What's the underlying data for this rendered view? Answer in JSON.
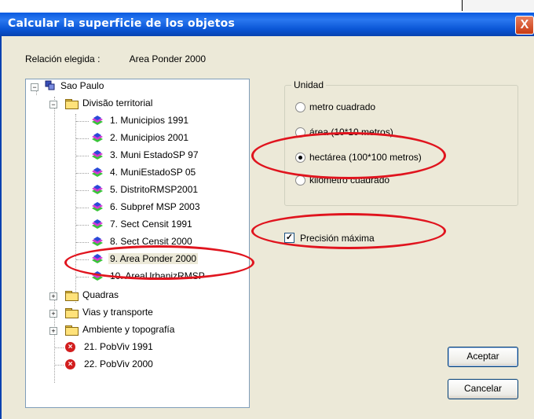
{
  "dialog": {
    "title": "Calcular la superficie de los objetos",
    "close_label": "X"
  },
  "relation": {
    "label": "Relación elegida :",
    "value": "Area Ponder 2000"
  },
  "tree": {
    "root": "Sao Paulo",
    "folder_divisao": "Divisão territorial",
    "layers": [
      "1. Municipios 1991",
      "2. Municipios 2001",
      "3. Muni EstadoSP 97",
      "4. MuniEstadoSP 05",
      "5. DistritoRMSP2001",
      "6. Subpref MSP 2003",
      "7. Sect Censit 1991",
      "8. Sect Censit 2000",
      "9. Area Ponder 2000",
      "10. AreaUrbanizRMSP"
    ],
    "selected_index": 8,
    "folders": [
      "Quadras",
      "Vias y transporte",
      "Ambiente y topografía"
    ],
    "error_layers": [
      "21. PobViv 1991",
      "22. PobViv 2000"
    ]
  },
  "units": {
    "legend": "Unidad",
    "options": [
      "metro cuadrado",
      "área (10*10 metros)",
      "hectárea (100*100 metros)",
      "kilómetro cuadrado"
    ],
    "selected_index": 2
  },
  "precision": {
    "label": "Precisión máxima",
    "checked": true
  },
  "buttons": {
    "accept": "Aceptar",
    "cancel": "Cancelar"
  },
  "colors": {
    "titlebar": "#0a5ae0",
    "annotation": "#e0141e",
    "dialog_bg": "#ece9d8"
  }
}
